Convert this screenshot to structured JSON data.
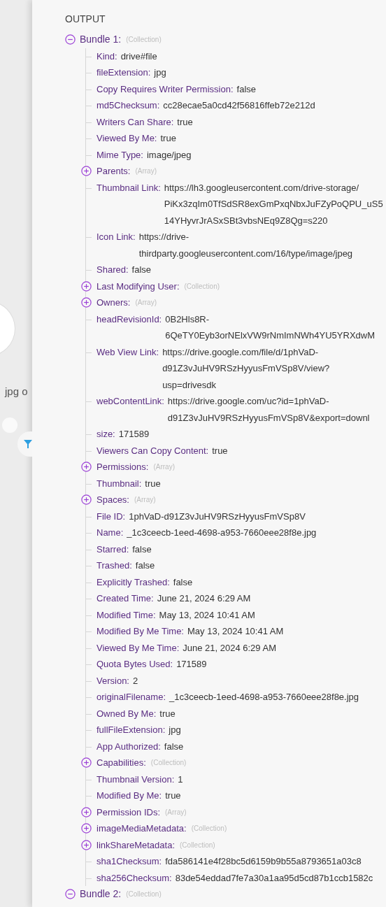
{
  "canvas": {
    "node_label": "jpg o"
  },
  "output": {
    "title": "OUTPUT",
    "bundles": [
      {
        "label": "Bundle 1:",
        "type": "(Collection)",
        "expanded": true,
        "children": [
          {
            "kind": "field",
            "key": "Kind:",
            "value": [
              "drive#file"
            ]
          },
          {
            "kind": "field",
            "key": "fileExtension:",
            "value": [
              "jpg"
            ]
          },
          {
            "kind": "field",
            "key": "Copy Requires Writer Permission:",
            "value": [
              "false"
            ]
          },
          {
            "kind": "field",
            "key": "md5Checksum:",
            "value": [
              "cc28ecae5a0cd42f56816ffeb72e212d"
            ]
          },
          {
            "kind": "field",
            "key": "Writers Can Share:",
            "value": [
              "true"
            ]
          },
          {
            "kind": "field",
            "key": "Viewed By Me:",
            "value": [
              "true"
            ]
          },
          {
            "kind": "field",
            "key": "Mime Type:",
            "value": [
              "image/jpeg"
            ]
          },
          {
            "kind": "node",
            "key": "Parents:",
            "type": "(Array)",
            "expanded": false
          },
          {
            "kind": "field",
            "key": "Thumbnail Link:",
            "value": [
              "https://lh3.googleusercontent.com/drive-storage/",
              "PiKx3zqIm0TfSdSR8exGmPxqNbxJuFZyPoQPU_uS5",
              "14YHyvrJrASxSBt3vbsNEq9Z8Qg=s220"
            ]
          },
          {
            "kind": "field",
            "key": "Icon Link:",
            "value": [
              "https://drive-",
              "thirdparty.googleusercontent.com/16/type/image/jpeg"
            ]
          },
          {
            "kind": "field",
            "key": "Shared:",
            "value": [
              "false"
            ]
          },
          {
            "kind": "node",
            "key": "Last Modifying User:",
            "type": "(Collection)",
            "expanded": false
          },
          {
            "kind": "node",
            "key": "Owners:",
            "type": "(Array)",
            "expanded": false
          },
          {
            "kind": "field",
            "key": "headRevisionId:",
            "value": [
              "0B2Hls8R-",
              "6QeTY0Eyb3orNElxVW9rNmImNWh4YU5YRXdwM"
            ]
          },
          {
            "kind": "field",
            "key": "Web View Link:",
            "value": [
              "https://drive.google.com/file/d/1phVaD-",
              "d91Z3vJuHV9RSzHyyusFmVSp8V/view?",
              "usp=drivesdk"
            ]
          },
          {
            "kind": "field",
            "key": "webContentLink:",
            "value": [
              "https://drive.google.com/uc?id=1phVaD-",
              "d91Z3vJuHV9RSzHyyusFmVSp8V&export=downl"
            ]
          },
          {
            "kind": "field",
            "key": "size:",
            "value": [
              "171589"
            ]
          },
          {
            "kind": "field",
            "key": "Viewers Can Copy Content:",
            "value": [
              "true"
            ]
          },
          {
            "kind": "node",
            "key": "Permissions:",
            "type": "(Array)",
            "expanded": false
          },
          {
            "kind": "field",
            "key": "Thumbnail:",
            "value": [
              "true"
            ]
          },
          {
            "kind": "node",
            "key": "Spaces:",
            "type": "(Array)",
            "expanded": false
          },
          {
            "kind": "field",
            "key": "File ID:",
            "value": [
              "1phVaD-d91Z3vJuHV9RSzHyyusFmVSp8V"
            ]
          },
          {
            "kind": "field",
            "key": "Name:",
            "value": [
              "_1c3ceecb-1eed-4698-a953-7660eee28f8e.jpg"
            ]
          },
          {
            "kind": "field",
            "key": "Starred:",
            "value": [
              "false"
            ]
          },
          {
            "kind": "field",
            "key": "Trashed:",
            "value": [
              "false"
            ]
          },
          {
            "kind": "field",
            "key": "Explicitly Trashed:",
            "value": [
              "false"
            ]
          },
          {
            "kind": "field",
            "key": "Created Time:",
            "value": [
              "June 21, 2024 6:29 AM"
            ]
          },
          {
            "kind": "field",
            "key": "Modified Time:",
            "value": [
              "May 13, 2024 10:41 AM"
            ]
          },
          {
            "kind": "field",
            "key": "Modified By Me Time:",
            "value": [
              "May 13, 2024 10:41 AM"
            ]
          },
          {
            "kind": "field",
            "key": "Viewed By Me Time:",
            "value": [
              "June 21, 2024 6:29 AM"
            ]
          },
          {
            "kind": "field",
            "key": "Quota Bytes Used:",
            "value": [
              "171589"
            ]
          },
          {
            "kind": "field",
            "key": "Version:",
            "value": [
              "2"
            ]
          },
          {
            "kind": "field",
            "key": "originalFilename:",
            "value": [
              "_1c3ceecb-1eed-4698-a953-7660eee28f8e.jpg"
            ]
          },
          {
            "kind": "field",
            "key": "Owned By Me:",
            "value": [
              "true"
            ]
          },
          {
            "kind": "field",
            "key": "fullFileExtension:",
            "value": [
              "jpg"
            ]
          },
          {
            "kind": "field",
            "key": "App Authorized:",
            "value": [
              "false"
            ]
          },
          {
            "kind": "node",
            "key": "Capabilities:",
            "type": "(Collection)",
            "expanded": false
          },
          {
            "kind": "field",
            "key": "Thumbnail Version:",
            "value": [
              "1"
            ]
          },
          {
            "kind": "field",
            "key": "Modified By Me:",
            "value": [
              "true"
            ]
          },
          {
            "kind": "node",
            "key": "Permission IDs:",
            "type": "(Array)",
            "expanded": false
          },
          {
            "kind": "node",
            "key": "imageMediaMetadata:",
            "type": "(Collection)",
            "expanded": false
          },
          {
            "kind": "node",
            "key": "linkShareMetadata:",
            "type": "(Collection)",
            "expanded": false
          },
          {
            "kind": "field",
            "key": "sha1Checksum:",
            "value": [
              "fda586141e4f28bc5d6159b9b55a8793651a03c8"
            ]
          },
          {
            "kind": "field",
            "key": "sha256Checksum:",
            "value": [
              "83de54eddad7fe7a30a1aa95d5cd87b1ccb1582c"
            ]
          }
        ]
      },
      {
        "label": "Bundle 2:",
        "type": "(Collection)",
        "expanded": true
      }
    ]
  }
}
